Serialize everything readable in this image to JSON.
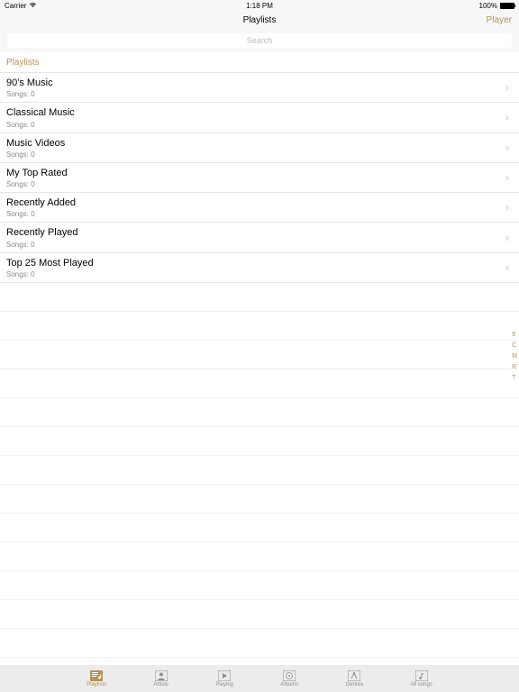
{
  "status": {
    "carrier": "Carrier",
    "time": "1:18 PM",
    "battery_pct": "100%"
  },
  "nav": {
    "title": "Playlists",
    "right": "Player"
  },
  "search": {
    "placeholder": "Search"
  },
  "section": {
    "header": "Playlists"
  },
  "playlists": [
    {
      "name": "90's Music",
      "sub": "Songs: 0"
    },
    {
      "name": "Classical Music",
      "sub": "Songs: 0"
    },
    {
      "name": "Music Videos",
      "sub": "Songs: 0"
    },
    {
      "name": "My Top Rated",
      "sub": "Songs: 0"
    },
    {
      "name": "Recently Added",
      "sub": "Songs: 0"
    },
    {
      "name": "Recently Played",
      "sub": "Songs: 0"
    },
    {
      "name": "Top 25 Most Played",
      "sub": "Songs: 0"
    }
  ],
  "index_letters": [
    "9",
    "C",
    "M",
    "R",
    "T"
  ],
  "tabs": [
    {
      "label": "Playlists"
    },
    {
      "label": "Artists"
    },
    {
      "label": "Playing"
    },
    {
      "label": "Albums"
    },
    {
      "label": "Genres"
    },
    {
      "label": "All songs"
    }
  ]
}
